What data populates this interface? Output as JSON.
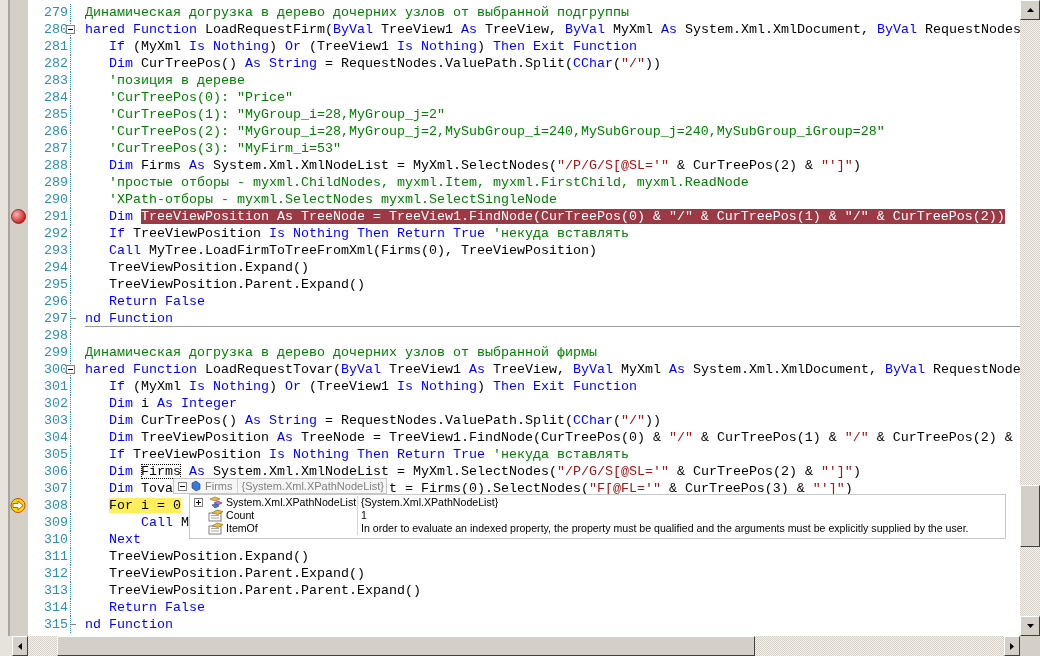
{
  "lines": [
    {
      "number": "279",
      "kind": "code",
      "tokens": [
        {
          "kind": "comment",
          "text": "Динамическая догрузка в дерево дочерних узлов от выбранной подгруппы"
        }
      ]
    },
    {
      "number": "280",
      "kind": "block-start",
      "tokens": [
        {
          "kind": "keyword",
          "text": "hared Function"
        },
        {
          "kind": "plain",
          "text": " LoadRequestFirm("
        },
        {
          "kind": "keyword",
          "text": "ByVal"
        },
        {
          "kind": "plain",
          "text": " TreeView1 "
        },
        {
          "kind": "keyword",
          "text": "As"
        },
        {
          "kind": "plain",
          "text": " TreeView, "
        },
        {
          "kind": "keyword",
          "text": "ByVal"
        },
        {
          "kind": "plain",
          "text": " MyXml "
        },
        {
          "kind": "keyword",
          "text": "As"
        },
        {
          "kind": "plain",
          "text": " System.Xml.XmlDocument, "
        },
        {
          "kind": "keyword",
          "text": "ByVal"
        },
        {
          "kind": "plain",
          "text": " RequestNodes"
        }
      ]
    },
    {
      "number": "281",
      "kind": "code",
      "tokens": [
        {
          "kind": "keyword",
          "text": "   If"
        },
        {
          "kind": "plain",
          "text": " (MyXml "
        },
        {
          "kind": "keyword",
          "text": "Is Nothing"
        },
        {
          "kind": "plain",
          "text": ") "
        },
        {
          "kind": "keyword",
          "text": "Or"
        },
        {
          "kind": "plain",
          "text": " (TreeView1 "
        },
        {
          "kind": "keyword",
          "text": "Is Nothing"
        },
        {
          "kind": "plain",
          "text": ") "
        },
        {
          "kind": "keyword",
          "text": "Then Exit Function"
        }
      ]
    },
    {
      "number": "282",
      "kind": "code",
      "tokens": [
        {
          "kind": "keyword",
          "text": "   Dim"
        },
        {
          "kind": "plain",
          "text": " CurTreePos() "
        },
        {
          "kind": "keyword",
          "text": "As String"
        },
        {
          "kind": "plain",
          "text": " = RequestNodes.ValuePath.Split("
        },
        {
          "kind": "keyword",
          "text": "CChar"
        },
        {
          "kind": "plain",
          "text": "("
        },
        {
          "kind": "string",
          "text": "\"/\""
        },
        {
          "kind": "plain",
          "text": "))"
        }
      ]
    },
    {
      "number": "283",
      "kind": "code",
      "tokens": [
        {
          "kind": "comment",
          "text": "   'позиция в дереве"
        }
      ]
    },
    {
      "number": "284",
      "kind": "code",
      "tokens": [
        {
          "kind": "comment",
          "text": "   'CurTreePos(0): \"Price\""
        }
      ]
    },
    {
      "number": "285",
      "kind": "code",
      "tokens": [
        {
          "kind": "comment",
          "text": "   'CurTreePos(1): \"MyGroup_i=28,MyGroup_j=2\""
        }
      ]
    },
    {
      "number": "286",
      "kind": "code",
      "tokens": [
        {
          "kind": "comment",
          "text": "   'CurTreePos(2): \"MyGroup_i=28,MyGroup_j=2,MySubGroup_i=240,MySubGroup_j=240,MySubGroup_iGroup=28\""
        }
      ]
    },
    {
      "number": "287",
      "kind": "code",
      "tokens": [
        {
          "kind": "comment",
          "text": "   'CurTreePos(3): \"MyFirm_i=53\""
        }
      ]
    },
    {
      "number": "288",
      "kind": "code",
      "tokens": [
        {
          "kind": "keyword",
          "text": "   Dim"
        },
        {
          "kind": "plain",
          "text": " Firms "
        },
        {
          "kind": "keyword",
          "text": "As"
        },
        {
          "kind": "plain",
          "text": " System.Xml.XmlNodeList = MyXml.SelectNodes("
        },
        {
          "kind": "string",
          "text": "\"/P/G/S[@SL='\""
        },
        {
          "kind": "plain",
          "text": " & CurTreePos(2) & "
        },
        {
          "kind": "string",
          "text": "\"']\""
        },
        {
          "kind": "plain",
          "text": ")"
        }
      ]
    },
    {
      "number": "289",
      "kind": "code",
      "tokens": [
        {
          "kind": "comment",
          "text": "   'простые отборы - myxml.ChildNodes, myxml.Item, myxml.FirstChild, myxml.ReadNode"
        }
      ]
    },
    {
      "number": "290",
      "kind": "code",
      "tokens": [
        {
          "kind": "comment",
          "text": "   'XPath-отборы - myxml.SelectNodes myxml.SelectSingleNode"
        }
      ]
    },
    {
      "number": "291",
      "kind": "breakpoint",
      "tokens": [
        {
          "kind": "keyword",
          "text": "   Dim "
        },
        {
          "kind": "breakpoint",
          "text": "TreeViewPosition As TreeNode = TreeView1.FindNode(CurTreePos(0) & \"/\" & CurTreePos(1) & \"/\" & CurTreePos(2))"
        }
      ]
    },
    {
      "number": "292",
      "kind": "code",
      "tokens": [
        {
          "kind": "keyword",
          "text": "   If"
        },
        {
          "kind": "plain",
          "text": " TreeViewPosition "
        },
        {
          "kind": "keyword",
          "text": "Is Nothing Then Return True"
        },
        {
          "kind": "comment",
          "text": " 'некуда вставлять"
        }
      ]
    },
    {
      "number": "293",
      "kind": "code",
      "tokens": [
        {
          "kind": "keyword",
          "text": "   Call"
        },
        {
          "kind": "plain",
          "text": " MyTree.LoadFirmToTreeFromXml(Firms(0), TreeViewPosition)"
        }
      ]
    },
    {
      "number": "294",
      "kind": "code",
      "tokens": [
        {
          "kind": "plain",
          "text": "   TreeViewPosition.Expand()"
        }
      ]
    },
    {
      "number": "295",
      "kind": "code",
      "tokens": [
        {
          "kind": "plain",
          "text": "   TreeViewPosition.Parent.Expand()"
        }
      ]
    },
    {
      "number": "296",
      "kind": "code",
      "tokens": [
        {
          "kind": "keyword",
          "text": "   Return False"
        }
      ]
    },
    {
      "number": "297",
      "kind": "block-end",
      "tokens": [
        {
          "kind": "keyword",
          "text": "nd Function"
        }
      ]
    },
    {
      "number": "298",
      "kind": "separator"
    },
    {
      "number": "299",
      "kind": "code",
      "tokens": [
        {
          "kind": "comment",
          "text": "Динамическая догрузка в дерево дочерних узлов от выбранной фирмы"
        }
      ]
    },
    {
      "number": "300",
      "kind": "block-start",
      "tokens": [
        {
          "kind": "keyword",
          "text": "hared Function"
        },
        {
          "kind": "plain",
          "text": " LoadRequestTovar("
        },
        {
          "kind": "keyword",
          "text": "ByVal"
        },
        {
          "kind": "plain",
          "text": " TreeView1 "
        },
        {
          "kind": "keyword",
          "text": "As"
        },
        {
          "kind": "plain",
          "text": " TreeView, "
        },
        {
          "kind": "keyword",
          "text": "ByVal"
        },
        {
          "kind": "plain",
          "text": " MyXml "
        },
        {
          "kind": "keyword",
          "text": "As"
        },
        {
          "kind": "plain",
          "text": " System.Xml.XmlDocument, "
        },
        {
          "kind": "keyword",
          "text": "ByVal"
        },
        {
          "kind": "plain",
          "text": " RequestNode"
        }
      ]
    },
    {
      "number": "301",
      "kind": "code",
      "tokens": [
        {
          "kind": "keyword",
          "text": "   If"
        },
        {
          "kind": "plain",
          "text": " (MyXml "
        },
        {
          "kind": "keyword",
          "text": "Is Nothing"
        },
        {
          "kind": "plain",
          "text": ") "
        },
        {
          "kind": "keyword",
          "text": "Or"
        },
        {
          "kind": "plain",
          "text": " (TreeView1 "
        },
        {
          "kind": "keyword",
          "text": "Is Nothing"
        },
        {
          "kind": "plain",
          "text": ") "
        },
        {
          "kind": "keyword",
          "text": "Then Exit Function"
        }
      ]
    },
    {
      "number": "302",
      "kind": "code",
      "tokens": [
        {
          "kind": "keyword",
          "text": "   Dim"
        },
        {
          "kind": "plain",
          "text": " i "
        },
        {
          "kind": "keyword",
          "text": "As Integer"
        }
      ]
    },
    {
      "number": "303",
      "kind": "code",
      "tokens": [
        {
          "kind": "keyword",
          "text": "   Dim"
        },
        {
          "kind": "plain",
          "text": " CurTreePos() "
        },
        {
          "kind": "keyword",
          "text": "As String"
        },
        {
          "kind": "plain",
          "text": " = RequestNodes.ValuePath.Split("
        },
        {
          "kind": "keyword",
          "text": "CChar"
        },
        {
          "kind": "plain",
          "text": "("
        },
        {
          "kind": "string",
          "text": "\"/\""
        },
        {
          "kind": "plain",
          "text": "))"
        }
      ]
    },
    {
      "number": "304",
      "kind": "code",
      "tokens": [
        {
          "kind": "keyword",
          "text": "   Dim"
        },
        {
          "kind": "plain",
          "text": " TreeViewPosition "
        },
        {
          "kind": "keyword",
          "text": "As"
        },
        {
          "kind": "plain",
          "text": " TreeNode = TreeView1.FindNode(CurTreePos(0) & "
        },
        {
          "kind": "string",
          "text": "\"/\""
        },
        {
          "kind": "plain",
          "text": " & CurTreePos(1) & "
        },
        {
          "kind": "string",
          "text": "\"/\""
        },
        {
          "kind": "plain",
          "text": " & CurTreePos(2) &"
        }
      ]
    },
    {
      "number": "305",
      "kind": "code",
      "tokens": [
        {
          "kind": "keyword",
          "text": "   If"
        },
        {
          "kind": "plain",
          "text": " TreeViewPosition "
        },
        {
          "kind": "keyword",
          "text": "Is Nothing Then Return True"
        },
        {
          "kind": "comment",
          "text": " 'некуда вставлять"
        }
      ]
    },
    {
      "number": "306",
      "kind": "code",
      "tokens": [
        {
          "kind": "keyword",
          "text": "   Dim "
        },
        {
          "kind": "hover",
          "text": "Firms"
        },
        {
          "kind": "keyword",
          "text": " As"
        },
        {
          "kind": "plain",
          "text": " System.Xml.XmlNodeList = MyXml.SelectNodes("
        },
        {
          "kind": "string",
          "text": "\"/P/G/S[@SL='\""
        },
        {
          "kind": "plain",
          "text": " & CurTreePos(2) & "
        },
        {
          "kind": "string",
          "text": "\"']\""
        },
        {
          "kind": "plain",
          "text": ")"
        }
      ]
    },
    {
      "number": "307",
      "kind": "code",
      "tokens": [
        {
          "kind": "keyword",
          "text": "   Dim"
        },
        {
          "kind": "plain",
          "text": " Tova"
        }
      ],
      "tail": [
        {
          "kind": "plain",
          "text": "t = Firms(0).SelectNodes("
        },
        {
          "kind": "string",
          "text": "\"F[@FL='\""
        },
        {
          "kind": "plain",
          "text": " & CurTreePos(3) & "
        },
        {
          "kind": "string",
          "text": "\"']\""
        },
        {
          "kind": "plain",
          "text": ")"
        }
      ]
    },
    {
      "number": "308",
      "kind": "current",
      "tokens": [
        {
          "kind": "current",
          "text": "For i = 0"
        }
      ]
    },
    {
      "number": "309",
      "kind": "code",
      "tokens": [
        {
          "kind": "keyword",
          "text": "       Call"
        },
        {
          "kind": "plain",
          "text": " M"
        }
      ]
    },
    {
      "number": "310",
      "kind": "code",
      "tokens": [
        {
          "kind": "keyword",
          "text": "   Next"
        }
      ]
    },
    {
      "number": "311",
      "kind": "code",
      "tokens": [
        {
          "kind": "plain",
          "text": "   TreeViewPosition.Expand()"
        }
      ]
    },
    {
      "number": "312",
      "kind": "code",
      "tokens": [
        {
          "kind": "plain",
          "text": "   TreeViewPosition.Parent.Expand()"
        }
      ]
    },
    {
      "number": "313",
      "kind": "code",
      "tokens": [
        {
          "kind": "plain",
          "text": "   TreeViewPosition.Parent.Parent.Expand()"
        }
      ]
    },
    {
      "number": "314",
      "kind": "code",
      "tokens": [
        {
          "kind": "keyword",
          "text": "   Return False"
        }
      ]
    },
    {
      "number": "315",
      "kind": "block-end",
      "tokens": [
        {
          "kind": "keyword",
          "text": "nd Function"
        }
      ]
    }
  ],
  "datatip": {
    "expression": "Firms",
    "value": "{System.Xml.XPathNodeList}",
    "expanded": true,
    "rows": [
      {
        "kind": "base",
        "expanded": false,
        "name": "System.Xml.XPathNodeList",
        "value": "{System.Xml.XPathNodeList}"
      },
      {
        "kind": "property",
        "name": "Count",
        "value": "1"
      },
      {
        "kind": "property",
        "name": "ItemOf",
        "value": "In order to evaluate an indexed property, the property must be qualified and the arguments must be explicitly supplied by the user."
      }
    ]
  }
}
